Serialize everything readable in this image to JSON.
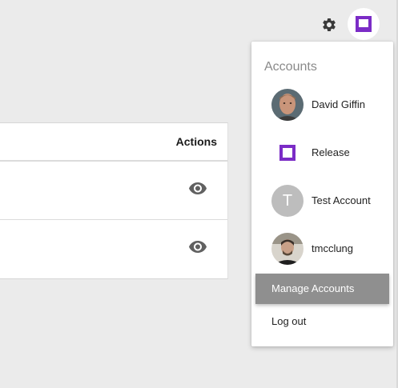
{
  "toolbar": {
    "settings_icon": "gear-icon",
    "account_icon": "release-logo-icon",
    "brand_color": "#7b2cc6"
  },
  "table": {
    "header_actions": "Actions",
    "rows": [
      {
        "action_icon": "eye-icon"
      },
      {
        "action_icon": "eye-icon"
      }
    ]
  },
  "account_menu": {
    "title": "Accounts",
    "accounts": [
      {
        "name": "David Giffin",
        "avatar": "photo"
      },
      {
        "name": "Release",
        "avatar": "release-logo-icon"
      },
      {
        "name": "Test Account",
        "avatar": "letter",
        "initial": "T"
      },
      {
        "name": "tmcclung",
        "avatar": "photo"
      }
    ],
    "manage_label": "Manage Accounts",
    "logout_label": "Log out"
  }
}
